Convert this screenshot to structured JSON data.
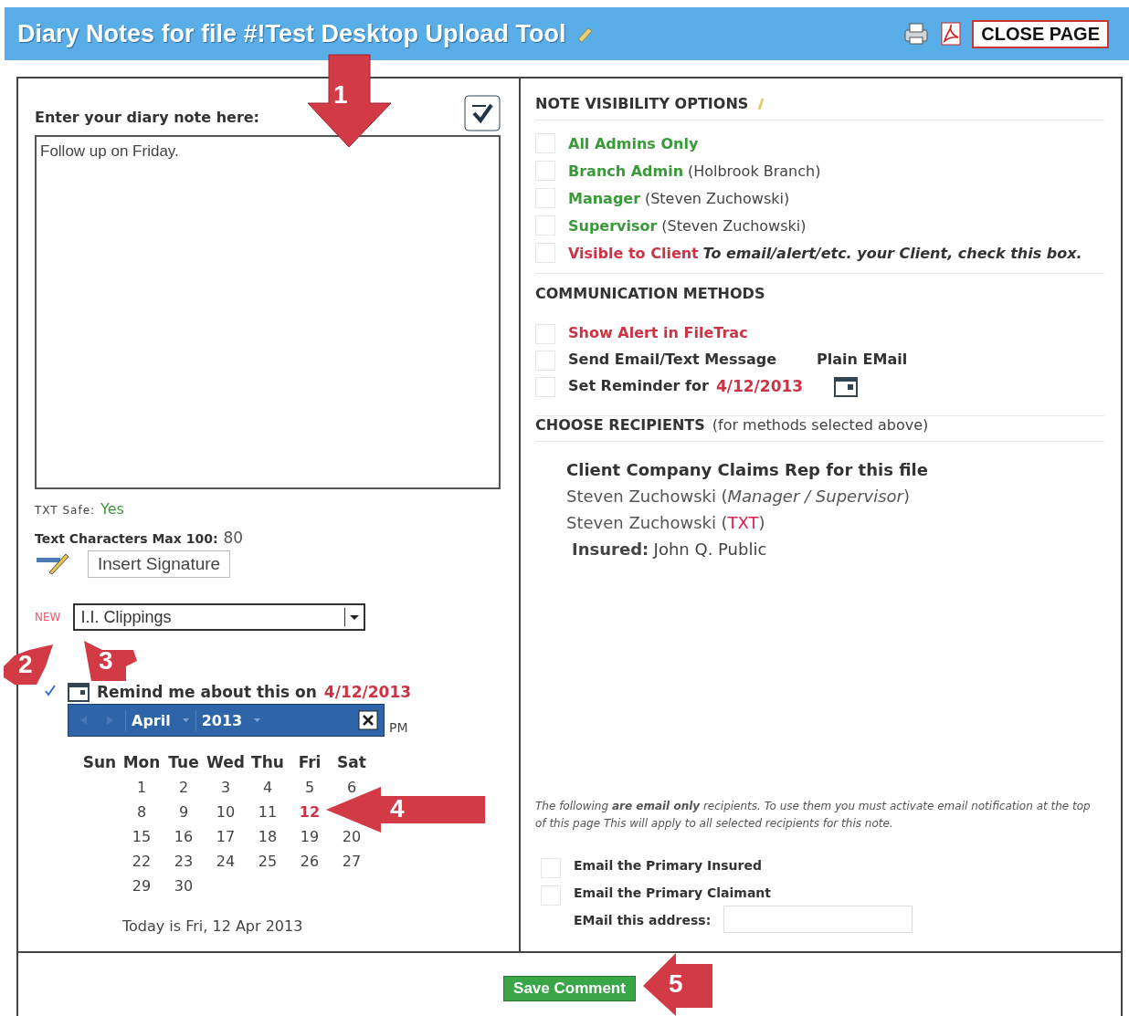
{
  "header": {
    "title": "Diary Notes for file #!Test Desktop Upload Tool",
    "close_button": "CLOSE PAGE"
  },
  "note_panel": {
    "label": "Enter your diary note here:",
    "note_text": "Follow up on Friday.",
    "txt_safe_label": "TXT Safe:",
    "txt_safe_value": "Yes",
    "char_label": "Text Characters Max 100:",
    "char_value": "80",
    "signature_button": "Insert Signature",
    "new_badge": "NEW",
    "category_select": "I.I. Clippings",
    "remind": {
      "label": "Remind me about this on",
      "date": "4/12/2013",
      "checked": true
    },
    "pm_text": "PM",
    "calendar": {
      "month": "April",
      "year": "2013",
      "weekdays": [
        "Sun",
        "Mon",
        "Tue",
        "Wed",
        "Thu",
        "Fri",
        "Sat"
      ],
      "weeks": [
        {
          "days": [
            {
              "label": "1",
              "selected": false
            },
            {
              "label": "2",
              "selected": false
            },
            {
              "label": "3",
              "selected": false
            },
            {
              "label": "4",
              "selected": false
            },
            {
              "label": "5",
              "selected": false
            },
            {
              "label": "6",
              "selected": false
            }
          ]
        },
        {
          "days": [
            {
              "label": "8",
              "selected": false
            },
            {
              "label": "9",
              "selected": false
            },
            {
              "label": "10",
              "selected": false
            },
            {
              "label": "11",
              "selected": false
            },
            {
              "label": "12",
              "selected": true
            }
          ]
        },
        {
          "days": [
            {
              "label": "15",
              "selected": false
            },
            {
              "label": "16",
              "selected": false
            },
            {
              "label": "17",
              "selected": false
            },
            {
              "label": "18",
              "selected": false
            },
            {
              "label": "19",
              "selected": false
            },
            {
              "label": "20",
              "selected": false
            }
          ]
        },
        {
          "days": [
            {
              "label": "22",
              "selected": false
            },
            {
              "label": "23",
              "selected": false
            },
            {
              "label": "24",
              "selected": false
            },
            {
              "label": "25",
              "selected": false
            },
            {
              "label": "26",
              "selected": false
            },
            {
              "label": "27",
              "selected": false
            }
          ]
        },
        {
          "days": [
            {
              "label": "29",
              "selected": false
            },
            {
              "label": "30",
              "selected": false
            }
          ]
        }
      ],
      "today_text": "Today is Fri, 12 Apr 2013"
    }
  },
  "visibility": {
    "title": "NOTE VISIBILITY OPTIONS",
    "options": [
      {
        "label": "All Admins Only",
        "color": "#3a9a3a",
        "checked": false
      },
      {
        "label": "Branch Admin",
        "detail": "(Holbrook Branch)",
        "color": "#3a9a3a",
        "checked": false
      },
      {
        "label": "Manager",
        "detail": "(Steven Zuchowski)",
        "color": "#3a9a3a",
        "checked": false
      },
      {
        "label": "Supervisor",
        "detail": "(Steven Zuchowski)",
        "color": "#3a9a3a",
        "checked": false
      },
      {
        "label": "Visible to Client",
        "note": "To email/alert/etc. your Client, check this box.",
        "color": "#cc3344",
        "checked": false
      }
    ]
  },
  "communication": {
    "title": "COMMUNICATION METHODS",
    "methods": [
      {
        "kind": "plain",
        "label": "Show Alert in FileTrac",
        "color": "#cc3344",
        "checked": false
      },
      {
        "kind": "email",
        "label": "Send Email/Text Message",
        "extra": "Plain EMail",
        "color": "#333333",
        "checked": false
      },
      {
        "kind": "reminder",
        "label": "Set Reminder for",
        "extra": "4/12/2013",
        "color": "#333333",
        "checked": false
      }
    ]
  },
  "recipients": {
    "title": "CHOOSE RECIPIENTS",
    "subtitle": "(for methods selected above)",
    "heading": "Client Company Claims Rep for this file",
    "rows": [
      {
        "kind": "person",
        "name": "Steven Zuchowski",
        "role_open": "(",
        "role": "Manager / Supervisor",
        "role_close": ")"
      },
      {
        "kind": "txt",
        "name": "Steven Zuchowski",
        "role_open": "(",
        "role": "TXT",
        "role_close": ")"
      },
      {
        "kind": "insured",
        "name": "Insured:",
        "role": "John Q. Public"
      }
    ]
  },
  "email_only": {
    "note": "The following **are email only** recipients. To use them you must activate email notification at the top of this page  This will apply to all selected recipients for this note.",
    "options": [
      {
        "label": "Email the Primary Insured",
        "checked": false
      },
      {
        "label": "Email the Primary Claimant",
        "checked": false
      }
    ],
    "address_label": "EMail this address:"
  },
  "save_button": "Save Comment",
  "callouts": [
    {
      "number": "1"
    },
    {
      "number": "2"
    },
    {
      "number": "3"
    },
    {
      "number": "4"
    },
    {
      "number": "5"
    }
  ]
}
